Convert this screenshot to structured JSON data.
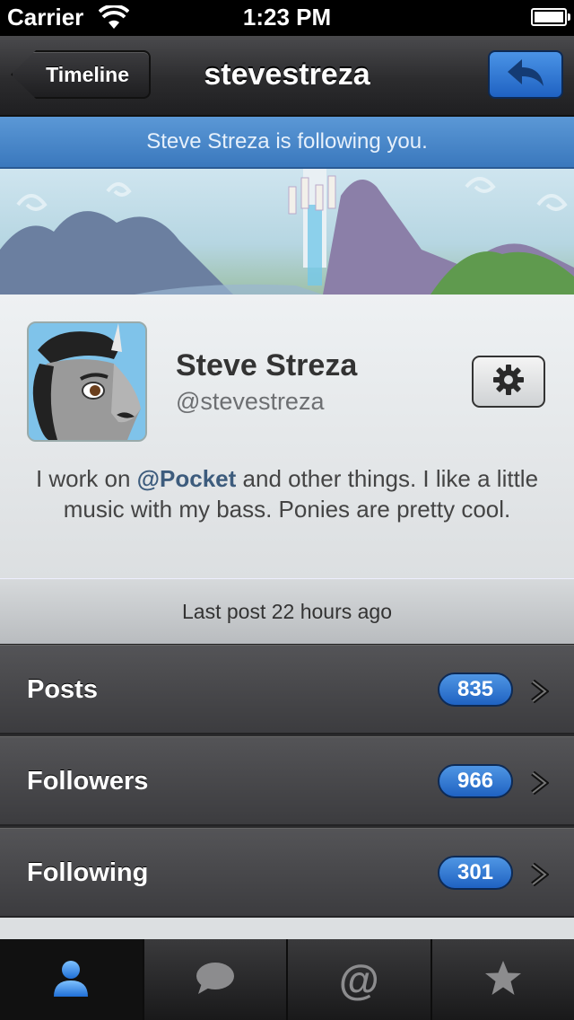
{
  "status_bar": {
    "carrier": "Carrier",
    "time": "1:23 PM"
  },
  "nav": {
    "back_label": "Timeline",
    "title": "stevestreza"
  },
  "banner": {
    "text": "Steve Streza is following you."
  },
  "profile": {
    "name": "Steve Streza",
    "handle": "@stevestreza",
    "bio_prefix": "I work on ",
    "bio_mention": "@Pocket",
    "bio_suffix": " and other things. I like a little music with my bass. Ponies are pretty cool."
  },
  "last_post": "Last post 22 hours ago",
  "stats": [
    {
      "label": "Posts",
      "count": "835"
    },
    {
      "label": "Followers",
      "count": "966"
    },
    {
      "label": "Following",
      "count": "301"
    }
  ],
  "tabs": [
    {
      "icon": "person-icon",
      "active": true
    },
    {
      "icon": "chat-bubble-icon",
      "active": false
    },
    {
      "icon": "at-icon",
      "label": "@",
      "active": false
    },
    {
      "icon": "star-icon",
      "active": false
    }
  ],
  "colors": {
    "accent": "#2f74d0",
    "banner": "#4a89cb"
  }
}
